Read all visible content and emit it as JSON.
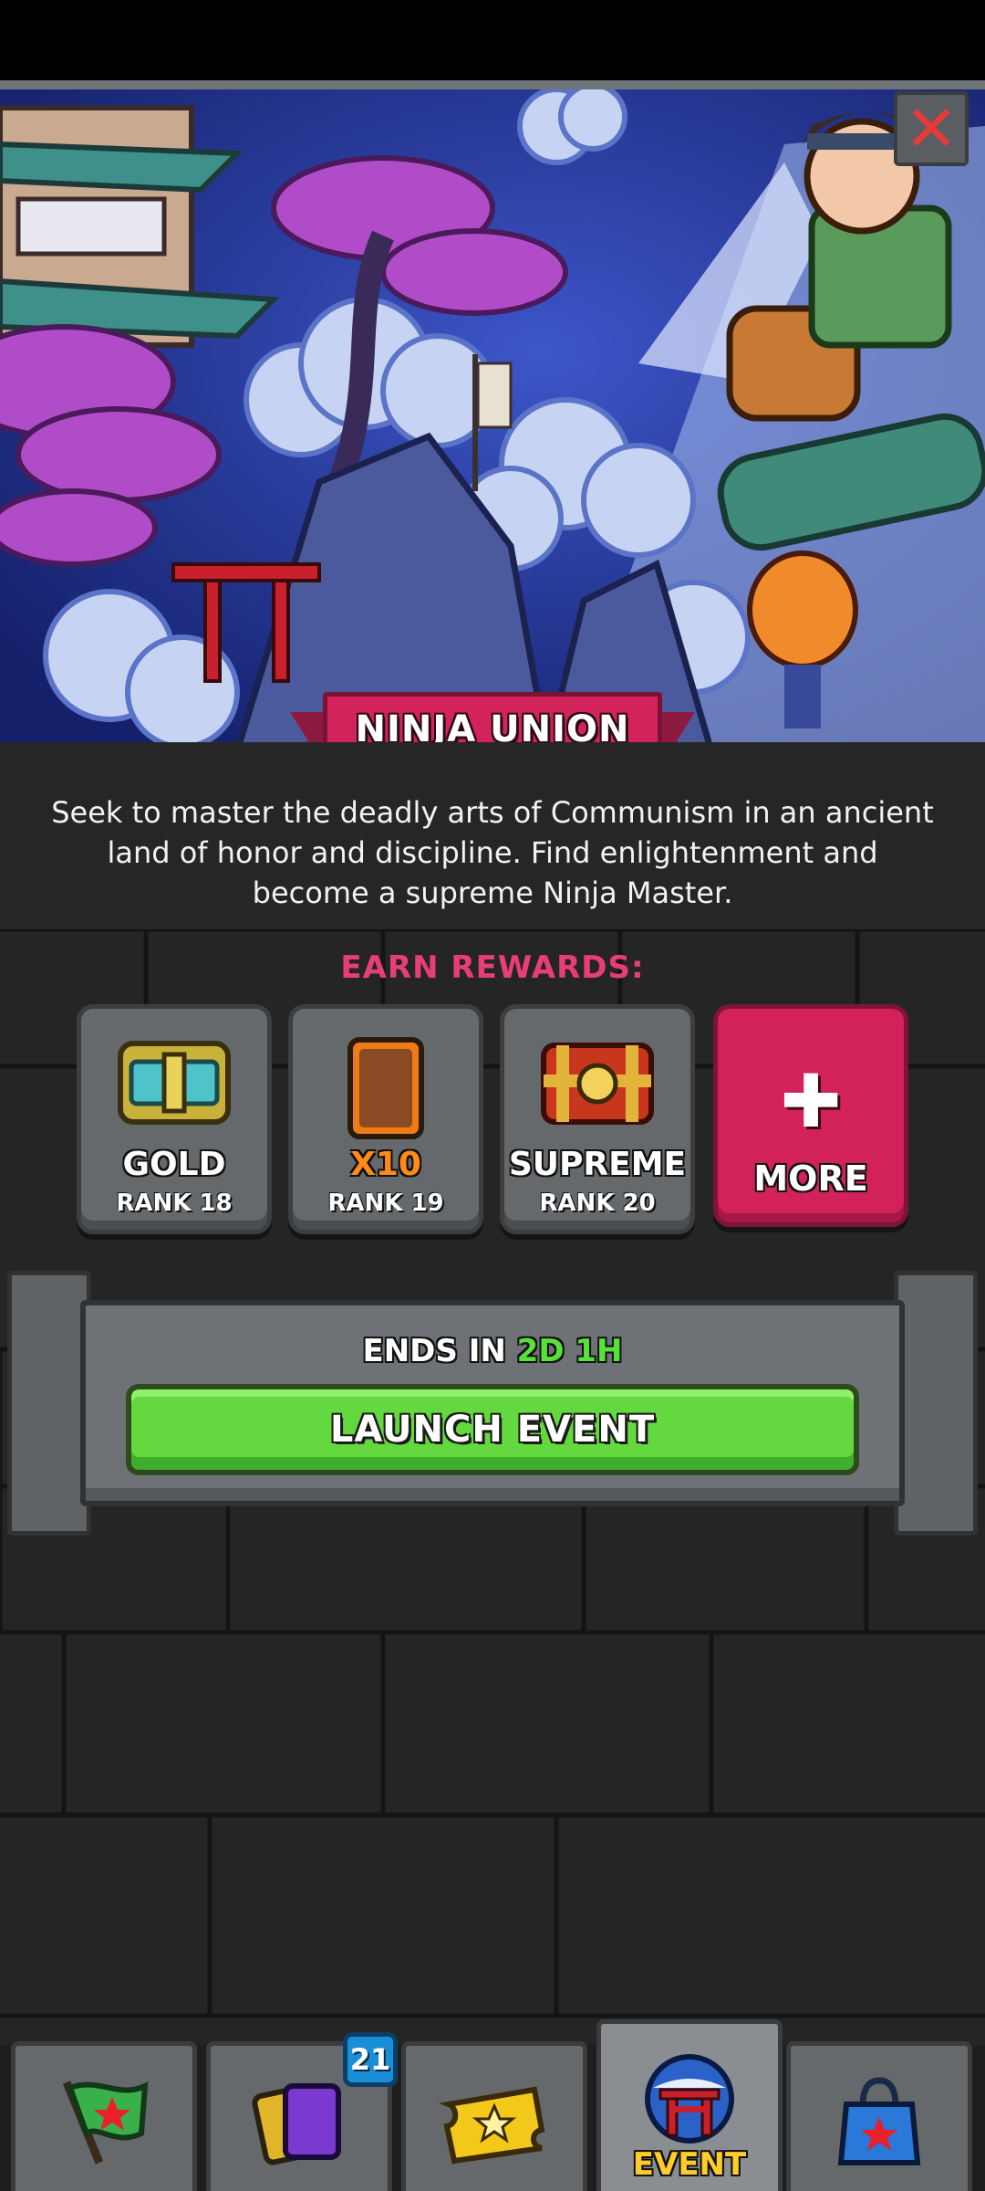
{
  "event": {
    "title": "NINJA UNION",
    "description": "Seek to master the deadly arts of Communism in an ancient land of honor and discipline. Find enlightenment and become a supreme Ninja Master.",
    "earn_rewards_label": "EARN REWARDS:",
    "close_icon": "close-icon"
  },
  "rewards": [
    {
      "name": "GOLD",
      "rank": "RANK 18",
      "icon": "gold-chest-icon"
    },
    {
      "name": "X10",
      "rank": "RANK 19",
      "icon": "card-icon"
    },
    {
      "name": "SUPREME",
      "rank": "RANK 20",
      "icon": "supreme-chest-icon"
    }
  ],
  "more": {
    "plus": "✚",
    "label": "MORE"
  },
  "timer": {
    "prefix": "ENDS IN",
    "value": "2D 1H"
  },
  "launch": {
    "label": "LAUNCH EVENT"
  },
  "nav": {
    "tabs": [
      {
        "name": "battle",
        "icon": "flag-icon"
      },
      {
        "name": "cards",
        "icon": "cards-icon",
        "badge": "21"
      },
      {
        "name": "tickets",
        "icon": "ticket-icon"
      },
      {
        "name": "event",
        "icon": "torii-gate-icon",
        "label": "EVENT",
        "active": true
      },
      {
        "name": "shop",
        "icon": "shopping-bag-icon"
      }
    ]
  },
  "colors": {
    "accent_pink": "#d2245a",
    "earn_rewards_pink": "#e83e78",
    "launch_green": "#64d93f",
    "timer_green": "#57e23a",
    "event_yellow": "#ffcc2a"
  }
}
